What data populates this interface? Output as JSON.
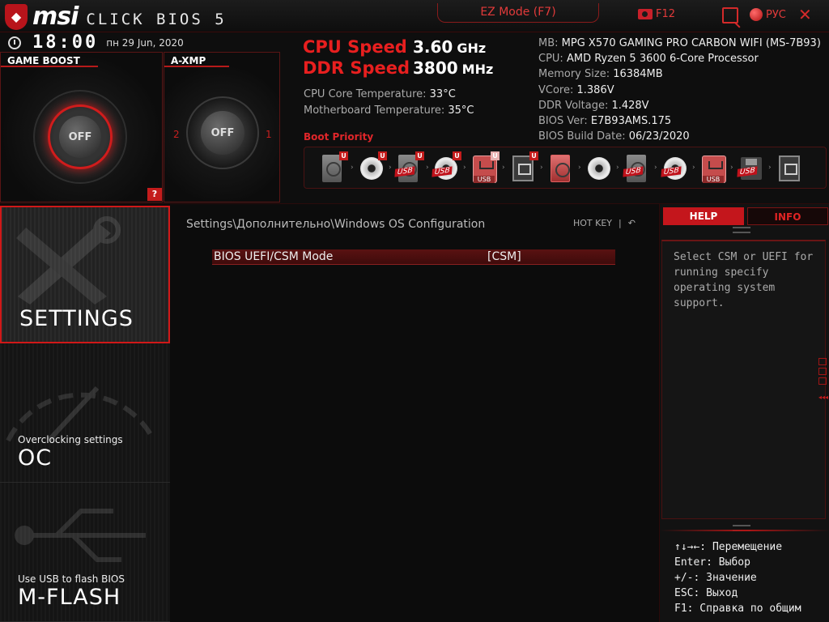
{
  "header": {
    "brand": "msi",
    "product": "CLICK BIOS 5",
    "ez_mode": "EZ Mode (F7)",
    "screenshot_key": "F12",
    "language": "РУС",
    "close": "✕"
  },
  "clock": {
    "time": "18:00",
    "date": "пн  29 Jun, 2020"
  },
  "game_boost": {
    "label": "GAME BOOST",
    "state": "OFF",
    "help": "?"
  },
  "axmp": {
    "label": "A-XMP",
    "state": "OFF",
    "profile_left": "2",
    "profile_right": "1"
  },
  "speeds": {
    "cpu_label": "CPU Speed",
    "cpu_value": "3.60",
    "cpu_unit": "GHz",
    "ddr_label": "DDR Speed",
    "ddr_value": "3800",
    "ddr_unit": "MHz"
  },
  "temps": {
    "cpu_label": "CPU Core Temperature: ",
    "cpu_value": "33°C",
    "mb_label": "Motherboard Temperature: ",
    "mb_value": "35°C"
  },
  "sysinfo": [
    {
      "label": "MB: ",
      "value": "MPG X570 GAMING PRO CARBON WIFI (MS-7B93)"
    },
    {
      "label": "CPU: ",
      "value": "AMD Ryzen 5 3600 6-Core Processor"
    },
    {
      "label": "Memory Size: ",
      "value": "16384MB"
    },
    {
      "label": "VCore: ",
      "value": "1.386V"
    },
    {
      "label": "DDR Voltage: ",
      "value": "1.428V"
    },
    {
      "label": "BIOS Ver: ",
      "value": "E7B93AMS.175"
    },
    {
      "label": "BIOS Build Date: ",
      "value": "06/23/2020"
    }
  ],
  "boot": {
    "title": "Boot Priority",
    "u": "U",
    "usb": "USB"
  },
  "nav": {
    "settings": "SETTINGS",
    "oc_sub": "Overclocking settings",
    "oc": "OC",
    "mflash_sub": "Use USB to flash BIOS",
    "mflash": "M-FLASH"
  },
  "center": {
    "breadcrumb": "Settings\\Дополнительно\\Windows OS Configuration",
    "hotkey": "HOT KEY",
    "hotkey_sep": "|",
    "back": "↶",
    "setting_name": "BIOS UEFI/CSM Mode",
    "setting_value": "[CSM]"
  },
  "right": {
    "tab_help": "HELP",
    "tab_info": "INFO",
    "help_text": "Select CSM or UEFI for running specify operating system support.",
    "keys": [
      "↑↓→←: Перемещение",
      "Enter: Выбор",
      "+/-: Значение",
      "ESC: Выход",
      "F1: Справка по общим"
    ]
  },
  "colors": {
    "accent": "#d01818",
    "text": "#eeeeee",
    "background": "#0b0b0b"
  }
}
